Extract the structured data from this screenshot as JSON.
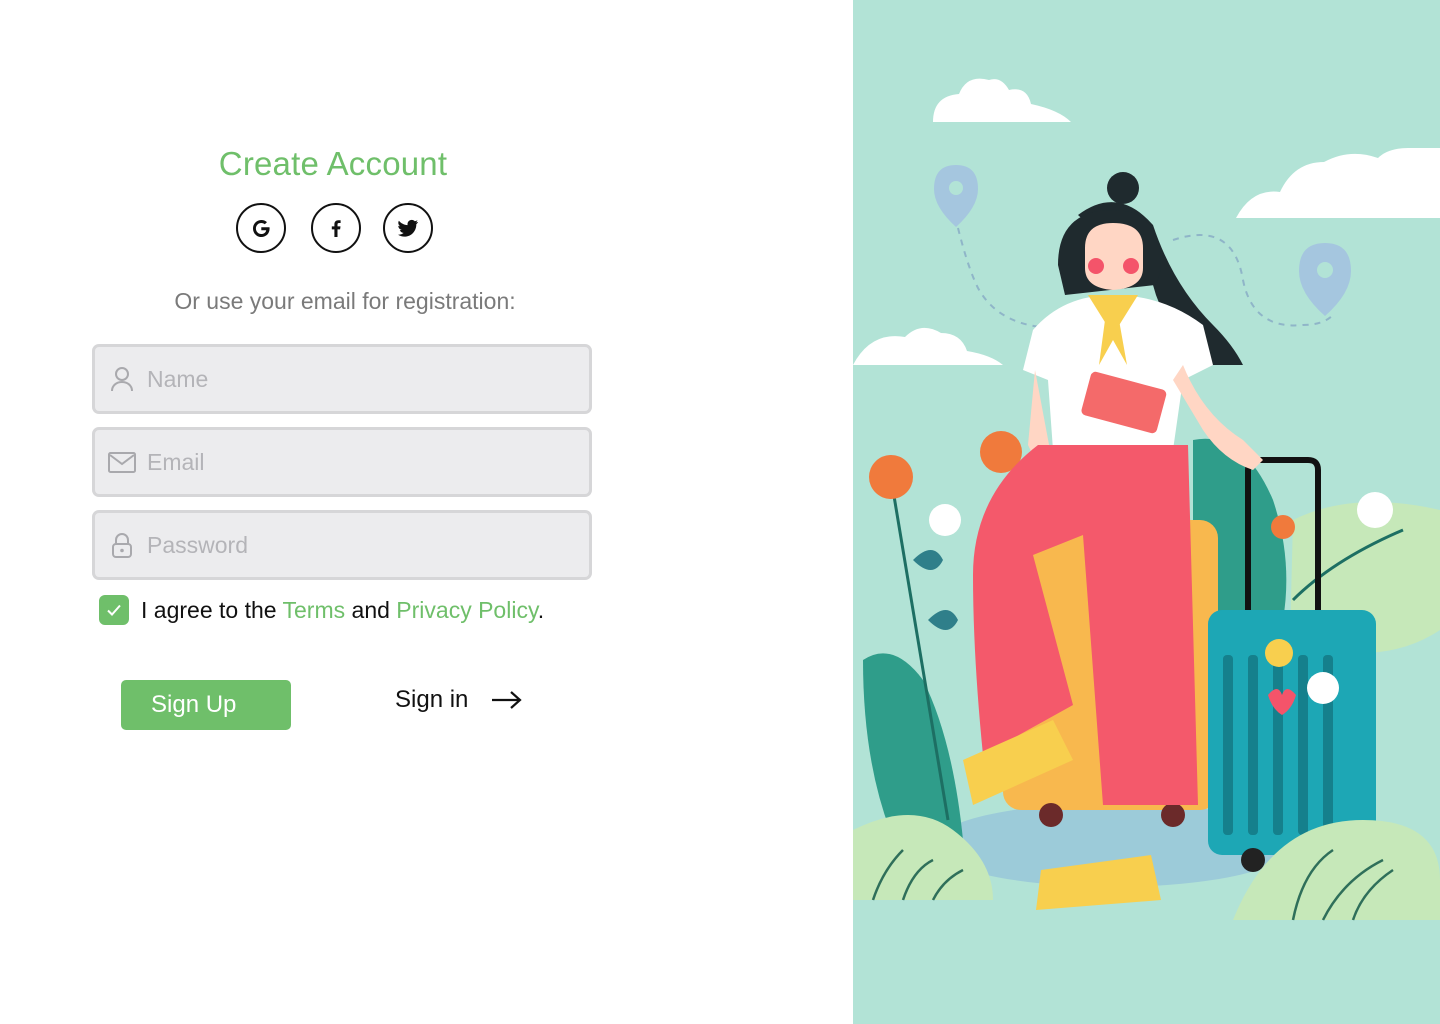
{
  "header": {
    "title": "Create Account"
  },
  "social": [
    {
      "name": "google",
      "icon": "google-icon"
    },
    {
      "name": "facebook",
      "icon": "facebook-icon"
    },
    {
      "name": "twitter",
      "icon": "twitter-icon"
    }
  ],
  "form": {
    "subtitle": "Or use your email for registration:",
    "name": {
      "placeholder": "Name",
      "value": "",
      "icon": "user-icon"
    },
    "email": {
      "placeholder": "Email",
      "value": "",
      "icon": "envelope-icon"
    },
    "password": {
      "placeholder": "Password",
      "value": "",
      "icon": "lock-icon"
    },
    "agreement": {
      "checked": true,
      "prefix": "I agree to the ",
      "terms": "Terms",
      "middle": " and ",
      "privacy": "Privacy Policy",
      "suffix": "."
    }
  },
  "actions": {
    "signup_label": "Sign Up",
    "signin_label": "Sign in",
    "signin_icon": "arrow-right-icon"
  },
  "colors": {
    "accent": "#6fbf6a",
    "panel_bg": "#b2e3d6",
    "field_bg": "#ececee",
    "field_border": "#d6d6d8"
  }
}
